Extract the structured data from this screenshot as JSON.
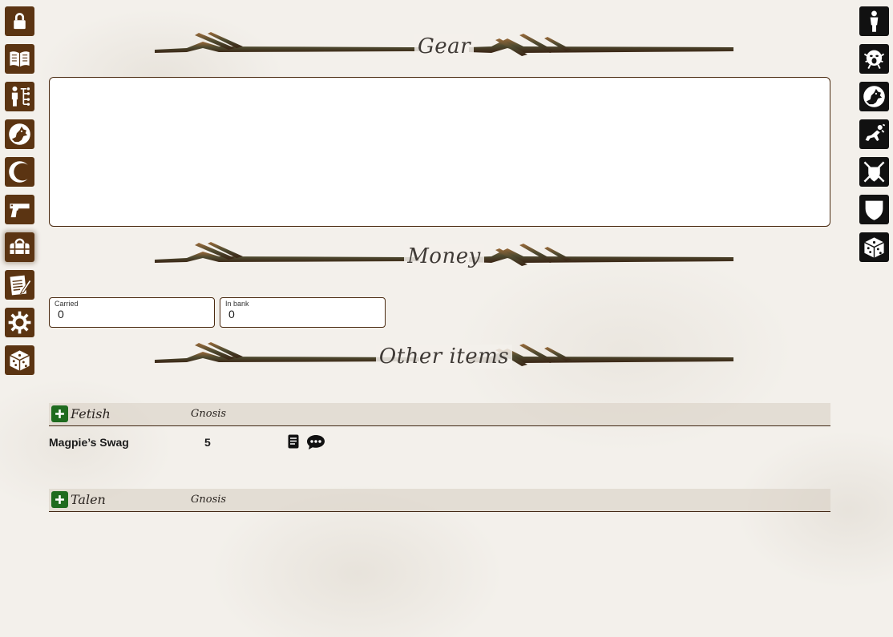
{
  "left_nav": [
    {
      "icon": "lock-icon",
      "active": false
    },
    {
      "icon": "book-icon",
      "active": false
    },
    {
      "icon": "character-tree-icon",
      "active": false
    },
    {
      "icon": "wolf-head-icon",
      "active": false
    },
    {
      "icon": "moon-icon",
      "active": false
    },
    {
      "icon": "pistol-icon",
      "active": false
    },
    {
      "icon": "duffel-bag-icon",
      "active": true
    },
    {
      "icon": "notepad-icon",
      "active": false
    },
    {
      "icon": "gear-icon",
      "active": false
    },
    {
      "icon": "dice-icon",
      "active": false
    }
  ],
  "right_nav": [
    {
      "icon": "person-icon"
    },
    {
      "icon": "screaming-face-icon"
    },
    {
      "icon": "wolf-head-icon"
    },
    {
      "icon": "falling-person-icon"
    },
    {
      "icon": "crossed-swords-shield-icon"
    },
    {
      "icon": "shield-icon"
    },
    {
      "icon": "dice-icon"
    }
  ],
  "sections": {
    "gear": {
      "title": "Gear",
      "content": ""
    },
    "money": {
      "title": "Money",
      "carried_label": "Carried",
      "carried_value": "0",
      "bank_label": "In bank",
      "bank_value": "0"
    },
    "other_items": {
      "title": "Other items"
    }
  },
  "fetish": {
    "header": "Fetish",
    "gnosis_header": "Gnosis",
    "items": [
      {
        "name": "Magpie’s Swag",
        "gnosis": "5",
        "actions": [
          "description-icon",
          "chat-icon"
        ]
      }
    ]
  },
  "talen": {
    "header": "Talen",
    "gnosis_header": "Gnosis",
    "items": []
  },
  "colors": {
    "nav_left_bg": "#5b3412",
    "nav_right_bg": "#111111",
    "add_button": "#1f6b1f",
    "border": "#4a2a10"
  }
}
